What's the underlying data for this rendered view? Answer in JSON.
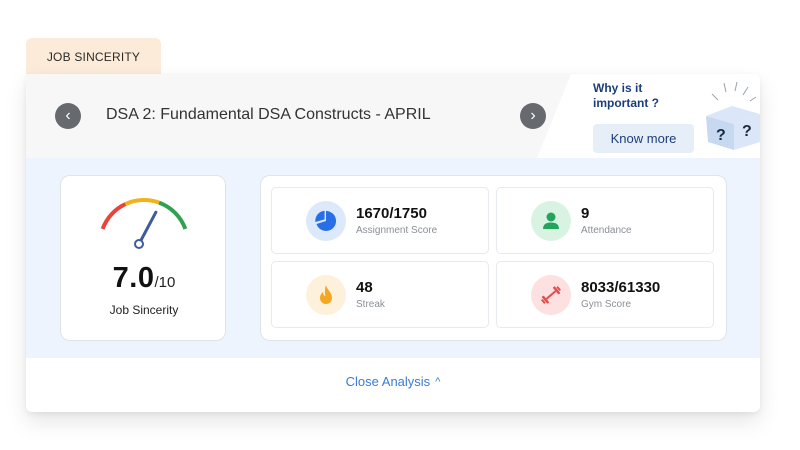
{
  "tab": {
    "label": "JOB SINCERITY"
  },
  "header": {
    "course_title": "DSA 2: Fundamental DSA Constructs - APRIL",
    "prev_glyph": "‹",
    "next_glyph": "›",
    "promo": {
      "question": "Why is it important ?",
      "button_label": "Know more",
      "box_glyph": "?"
    }
  },
  "gauge": {
    "value": "7.0",
    "max": "/10",
    "label": "Job Sincerity",
    "fraction": 0.7,
    "colors": [
      "#e8443a",
      "#f2b21b",
      "#2fa24f"
    ],
    "needle_color": "#3d5c99"
  },
  "stats": [
    {
      "value": "1670/1750",
      "label": "Assignment Score",
      "icon": "pie-chart-icon",
      "icon_color": "#2a6ee6",
      "icon_bg": "#dce9fb"
    },
    {
      "value": "9",
      "label": "Attendance",
      "icon": "person-icon",
      "icon_color": "#23a35c",
      "icon_bg": "#d9f3e3"
    },
    {
      "value": "48",
      "label": "Streak",
      "icon": "flame-icon",
      "icon_color": "#f5a623",
      "icon_bg": "#fdf1dc"
    },
    {
      "value": "8033/61330",
      "label": "Gym Score",
      "icon": "dumbbell-icon",
      "icon_color": "#e54b4b",
      "icon_bg": "#fde0e0"
    }
  ],
  "footer": {
    "close_label": "Close Analysis",
    "chevron": "^"
  }
}
